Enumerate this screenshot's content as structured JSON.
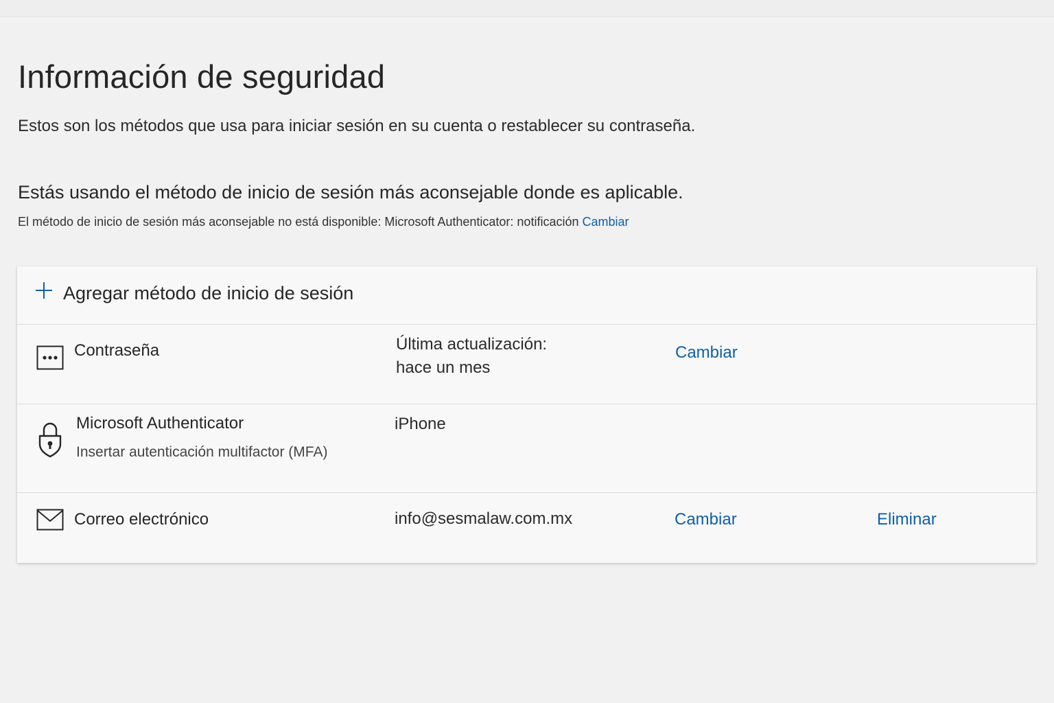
{
  "header": {
    "title": "Información de seguridad",
    "subtitle": "Estos son los métodos que usa para iniciar sesión en su cuenta o restablecer su contraseña."
  },
  "default_method": {
    "heading": "Estás usando el método de inicio de sesión más aconsejable donde es aplicable.",
    "note": "El método de inicio de sesión más aconsejable no está disponible: Microsoft Authenticator: notificación",
    "change_link": "Cambiar"
  },
  "methods_card": {
    "add_label": "Agregar método de inicio de sesión",
    "rows": [
      {
        "icon": "password-dots-icon",
        "name": "Contraseña",
        "detail_line1": "Última actualización:",
        "detail_line2": "hace un mes",
        "change_label": "Cambiar"
      },
      {
        "icon": "lock-icon",
        "name": "Microsoft Authenticator",
        "subtitle": "Insertar autenticación multifactor (MFA)",
        "detail": "iPhone"
      },
      {
        "icon": "mail-icon",
        "name": "Correo electrónico",
        "detail": "info@sesmalaw.com.mx",
        "change_label": "Cambiar",
        "delete_label": "Eliminar"
      }
    ]
  },
  "colors": {
    "accent": "#0f5fa8",
    "background": "#f1f1f1",
    "card": "#f8f8f8"
  }
}
